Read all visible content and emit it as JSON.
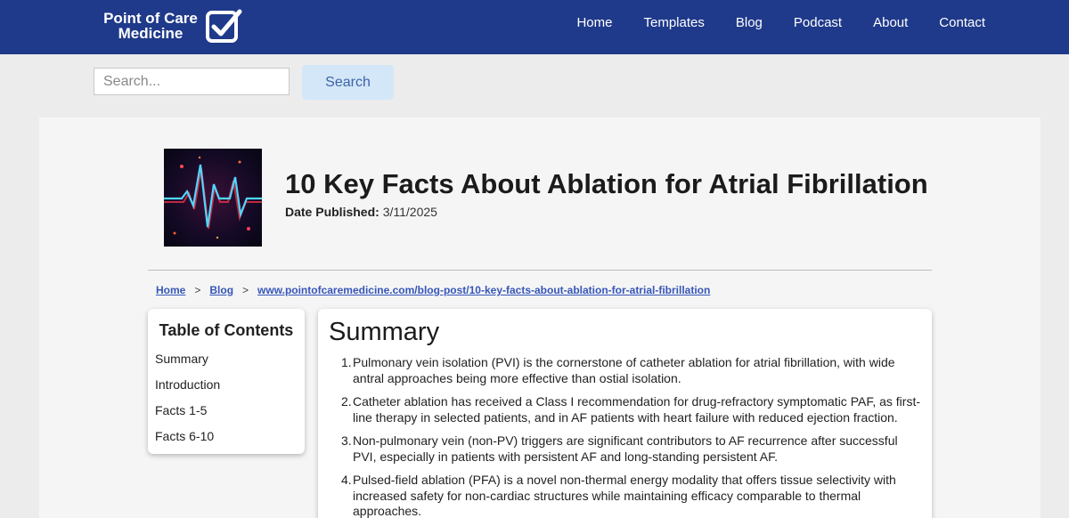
{
  "header": {
    "logo_line1": "Point of Care",
    "logo_line2": "Medicine",
    "nav": [
      "Home",
      "Templates",
      "Blog",
      "Podcast",
      "About",
      "Contact"
    ]
  },
  "search": {
    "placeholder": "Search...",
    "button_label": "Search"
  },
  "post": {
    "title": "10 Key Facts About Ablation for Atrial Fibrillation",
    "date_label": "Date Published:",
    "date_value": "3/11/2025"
  },
  "breadcrumb": {
    "items": [
      "Home",
      "Blog",
      "www.pointofcaremedicine.com/blog-post/10-key-facts-about-ablation-for-atrial-fibrillation"
    ],
    "separator": ">"
  },
  "toc": {
    "title": "Table of Contents",
    "items": [
      "Summary",
      "Introduction",
      "Facts 1-5",
      "Facts 6-10"
    ]
  },
  "summary": {
    "title": "Summary",
    "items": [
      "Pulmonary vein isolation (PVI) is the cornerstone of catheter ablation for atrial fibrillation, with wide antral approaches being more effective than ostial isolation.",
      "Catheter ablation has received a Class I recommendation for drug-refractory symptomatic PAF, as first-line therapy in selected patients, and in AF patients with heart failure with reduced ejection fraction.",
      "Non-pulmonary vein (non-PV) triggers are significant contributors to AF recurrence after successful PVI, especially in patients with persistent AF and long-standing persistent AF.",
      "Pulsed-field ablation (PFA) is a novel non-thermal energy modality that offers tissue selectivity with increased safety for non-cardiac structures while maintaining efficacy comparable to thermal approaches."
    ]
  },
  "colors": {
    "header_bg": "#1f3a8a",
    "link": "#3656b8",
    "search_button_bg": "#d3e7f9"
  }
}
